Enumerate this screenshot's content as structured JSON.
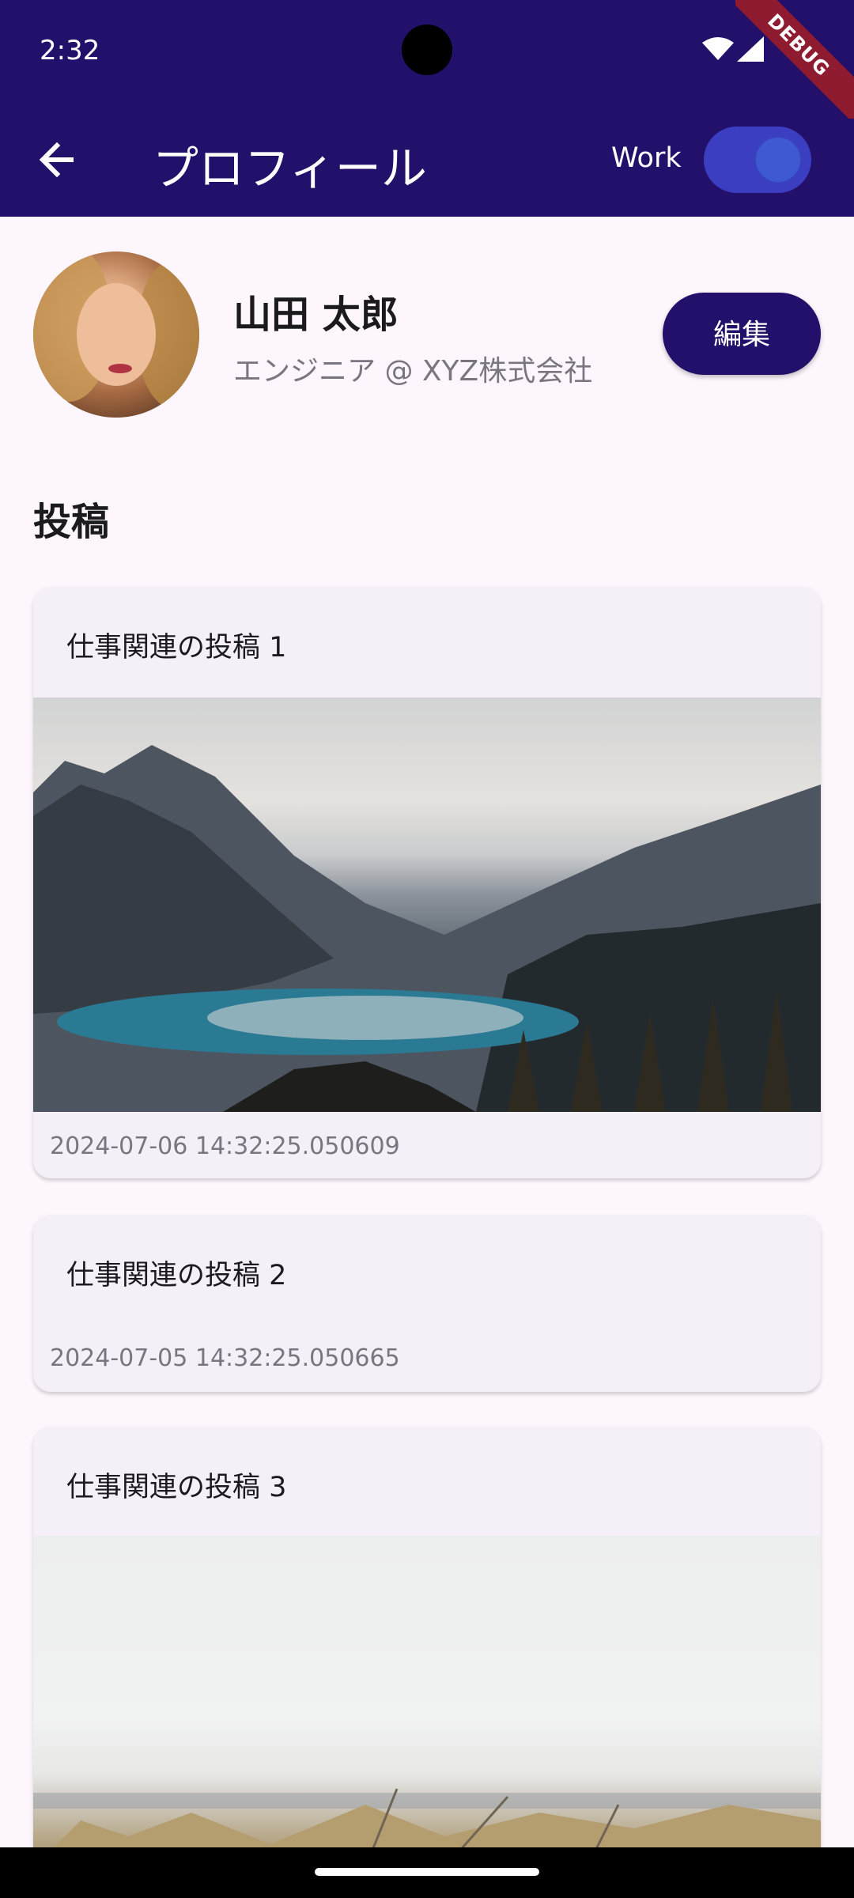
{
  "status_bar": {
    "time": "2:32",
    "debug_label": "DEBUG"
  },
  "app_bar": {
    "title": "プロフィール",
    "work_label": "Work",
    "work_enabled": true
  },
  "profile": {
    "name": "山田 太郎",
    "role": "エンジニア @ XYZ株式会社",
    "edit_label": "編集"
  },
  "section": {
    "title": "投稿"
  },
  "posts": [
    {
      "title": "仕事関連の投稿 1",
      "timestamp": "2024-07-06 14:32:25.050609",
      "image": "mountain-lake-photo"
    },
    {
      "title": "仕事関連の投稿 2",
      "timestamp": "2024-07-05 14:32:25.050665"
    },
    {
      "title": "仕事関連の投稿 3",
      "image": "beach-grass-photo"
    }
  ],
  "colors": {
    "app_bar": "#22106a",
    "background": "#fdf7fd",
    "card": "#f5f0f7",
    "switch_track": "#3b3ec0"
  }
}
